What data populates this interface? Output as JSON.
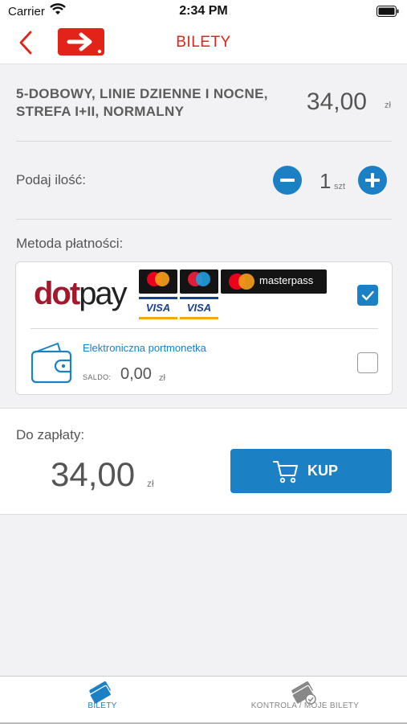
{
  "status_bar": {
    "carrier": "Carrier",
    "time": "2:34 PM"
  },
  "nav": {
    "title": "BILETY",
    "back_icon": "chevron-left-icon",
    "logo_icon": "arrow-right-logo-icon"
  },
  "ticket": {
    "name": "5-DOBOWY, LINIE DZIENNE I NOCNE, STREFA I+II, NORMALNY",
    "price": "34,00",
    "currency": "zł"
  },
  "quantity": {
    "label": "Podaj ilość:",
    "value": "1",
    "unit": "szt"
  },
  "payment": {
    "label": "Metoda płatności:",
    "methods": [
      {
        "id": "dotpay",
        "brand_dot": "dot",
        "brand_pay": "pay",
        "logos": [
          "mastercard",
          "maestro",
          "masterpass",
          "visa",
          "visa-electron"
        ],
        "visa_text": "VISA",
        "masterpass_text": "masterpass",
        "checked": true
      },
      {
        "id": "wallet",
        "name": "Elektroniczna portmonetka",
        "balance_label": "SALDO:",
        "balance_value": "0,00",
        "balance_currency": "zł",
        "checked": false
      }
    ]
  },
  "summary": {
    "label": "Do zapłaty:",
    "amount": "34,00",
    "currency": "zł",
    "buy_label": "KUP"
  },
  "tabs": [
    {
      "label": "BILETY",
      "icon": "tickets-icon",
      "active": true
    },
    {
      "label": "KONTROLA / MOJE BILETY",
      "icon": "my-tickets-icon",
      "active": false
    }
  ],
  "colors": {
    "brand_red": "#e2231a",
    "accent_blue": "#1c80c5",
    "dotpay_red": "#a3192c"
  }
}
